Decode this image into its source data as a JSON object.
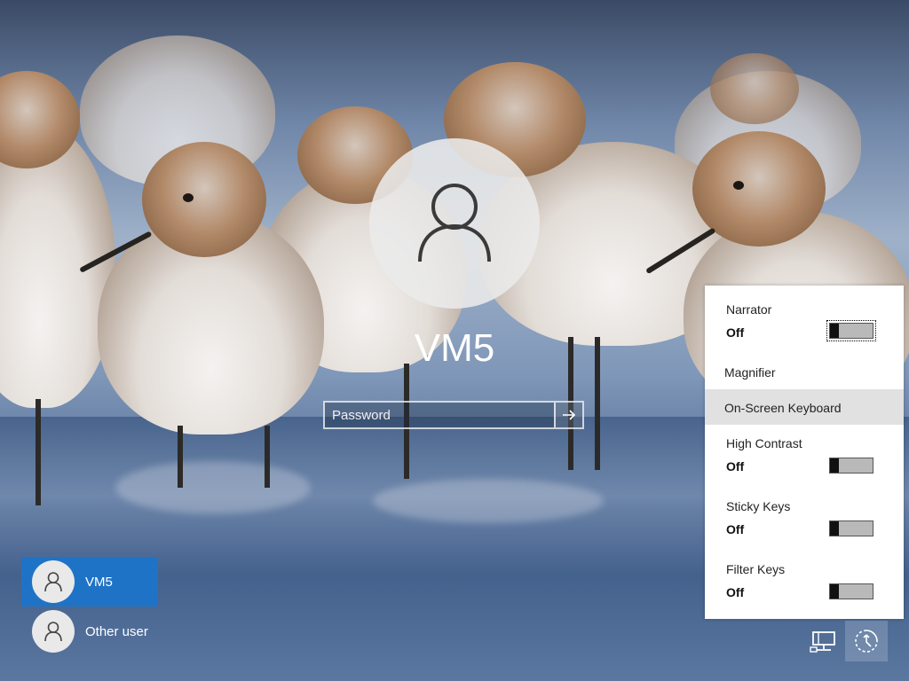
{
  "login": {
    "username": "VM5",
    "password_placeholder": "Password"
  },
  "users": [
    {
      "name": "VM5",
      "active": true
    },
    {
      "name": "Other user",
      "active": false
    }
  ],
  "ease_of_access": {
    "items": [
      {
        "label": "Narrator",
        "state": "Off",
        "has_toggle": true
      },
      {
        "label": "Magnifier",
        "has_toggle": false
      },
      {
        "label": "On-Screen Keyboard",
        "has_toggle": false,
        "highlighted": true
      },
      {
        "label": "High Contrast",
        "state": "Off",
        "has_toggle": true
      },
      {
        "label": "Sticky Keys",
        "state": "Off",
        "has_toggle": true
      },
      {
        "label": "Filter Keys",
        "state": "Off",
        "has_toggle": true
      }
    ]
  },
  "system_icons": [
    "network-icon",
    "ease-of-access-icon"
  ],
  "colors": {
    "accent": "#1f73c7",
    "menu_highlight": "#e1e1e1"
  }
}
